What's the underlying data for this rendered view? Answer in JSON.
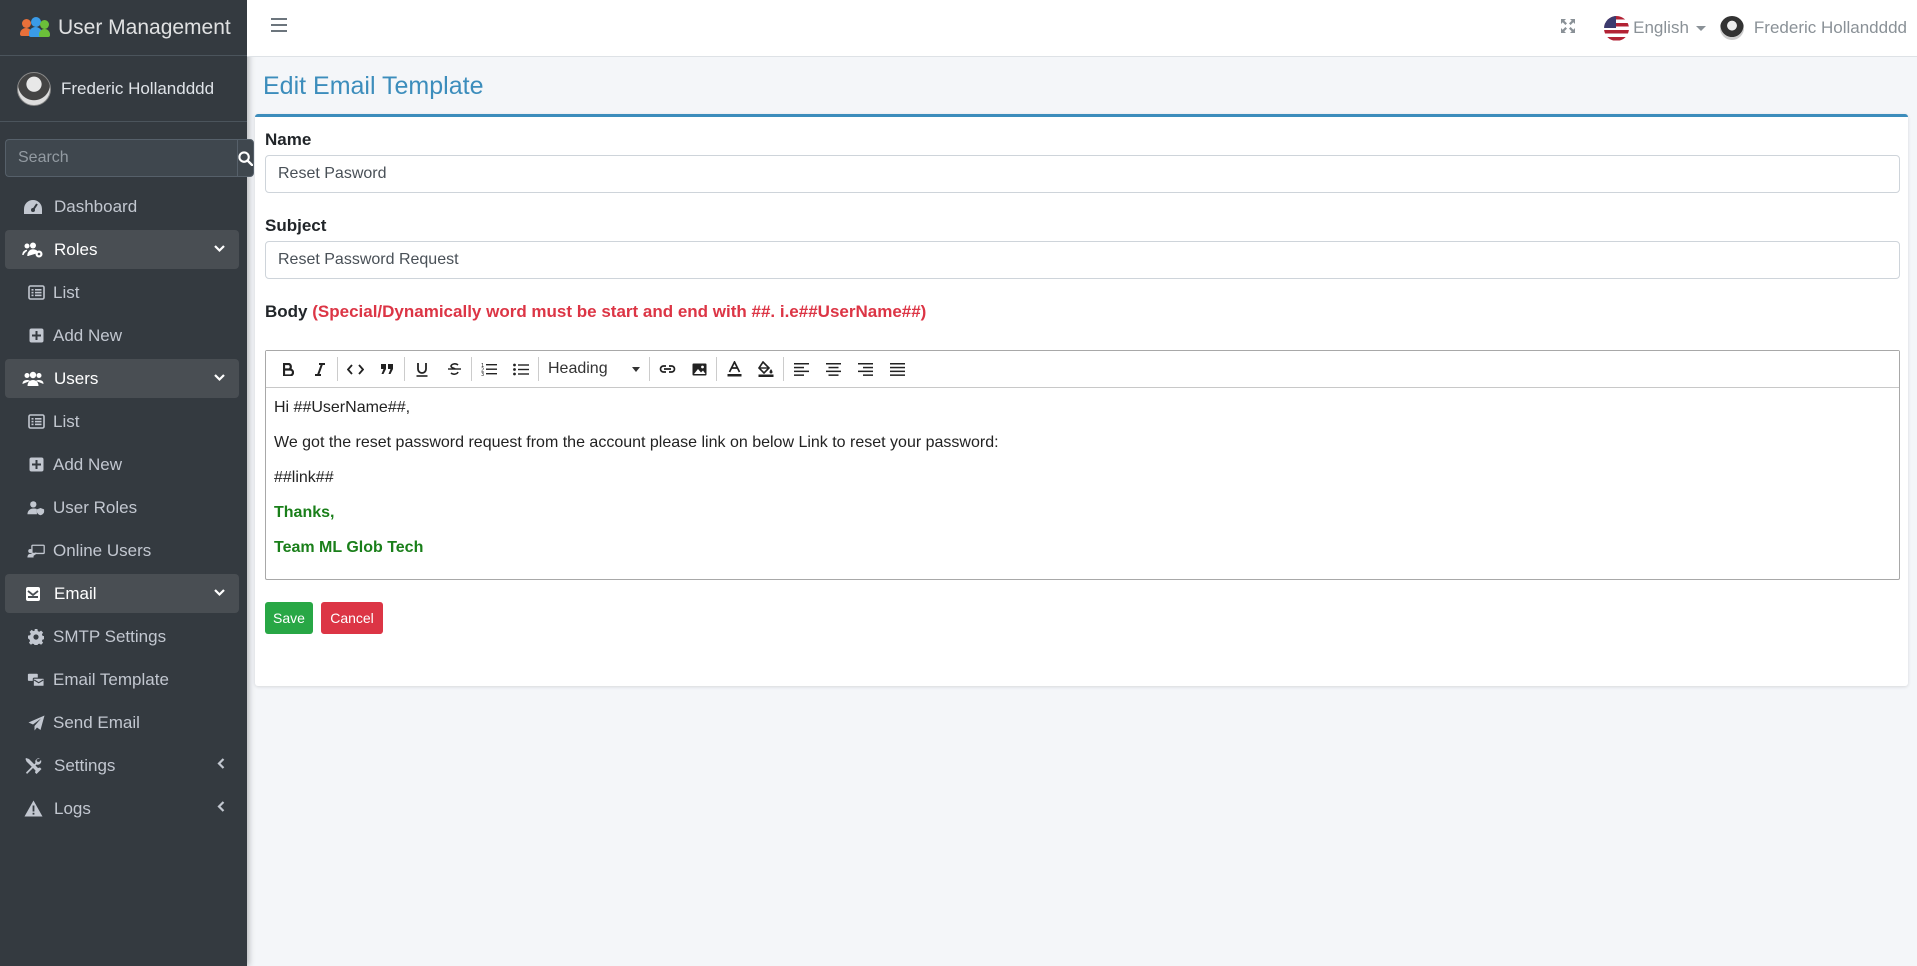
{
  "app": {
    "title": "User Management"
  },
  "user": {
    "name": "Frederic Hollandddd"
  },
  "search": {
    "placeholder": "Search"
  },
  "sidebar": {
    "items": [
      {
        "label": "Dashboard"
      },
      {
        "label": "Roles"
      },
      {
        "label": "List"
      },
      {
        "label": "Add New"
      },
      {
        "label": "Users"
      },
      {
        "label": "List"
      },
      {
        "label": "Add New"
      },
      {
        "label": "User Roles"
      },
      {
        "label": "Online Users"
      },
      {
        "label": "Email"
      },
      {
        "label": "SMTP Settings"
      },
      {
        "label": "Email Template"
      },
      {
        "label": "Send Email"
      },
      {
        "label": "Settings"
      },
      {
        "label": "Logs"
      }
    ]
  },
  "topbar": {
    "language": "English",
    "user_name": "Frederic Hollandddd"
  },
  "page": {
    "title": "Edit Email Template"
  },
  "form": {
    "name_label": "Name",
    "name_value": "Reset Pasword",
    "subject_label": "Subject",
    "subject_value": "Reset Password Request",
    "body_label": "Body",
    "body_hint": "(Special/Dynamically word must be start and end with ##. i.e##UserName##)",
    "heading_select": "Heading",
    "body_lines": {
      "line1": "Hi ##UserName##,",
      "line2": "We got the reset password request from the account please link on below Link to reset your password:",
      "line3": "##link##",
      "line4": "Thanks,",
      "line5": "Team ML Glob Tech"
    },
    "save_label": "Save",
    "cancel_label": "Cancel"
  },
  "colors": {
    "accent": "#3c8dbc",
    "sidebar_bg": "#343a40",
    "save": "#28a745",
    "cancel": "#dc3545",
    "signature": "#1a7f1a"
  }
}
